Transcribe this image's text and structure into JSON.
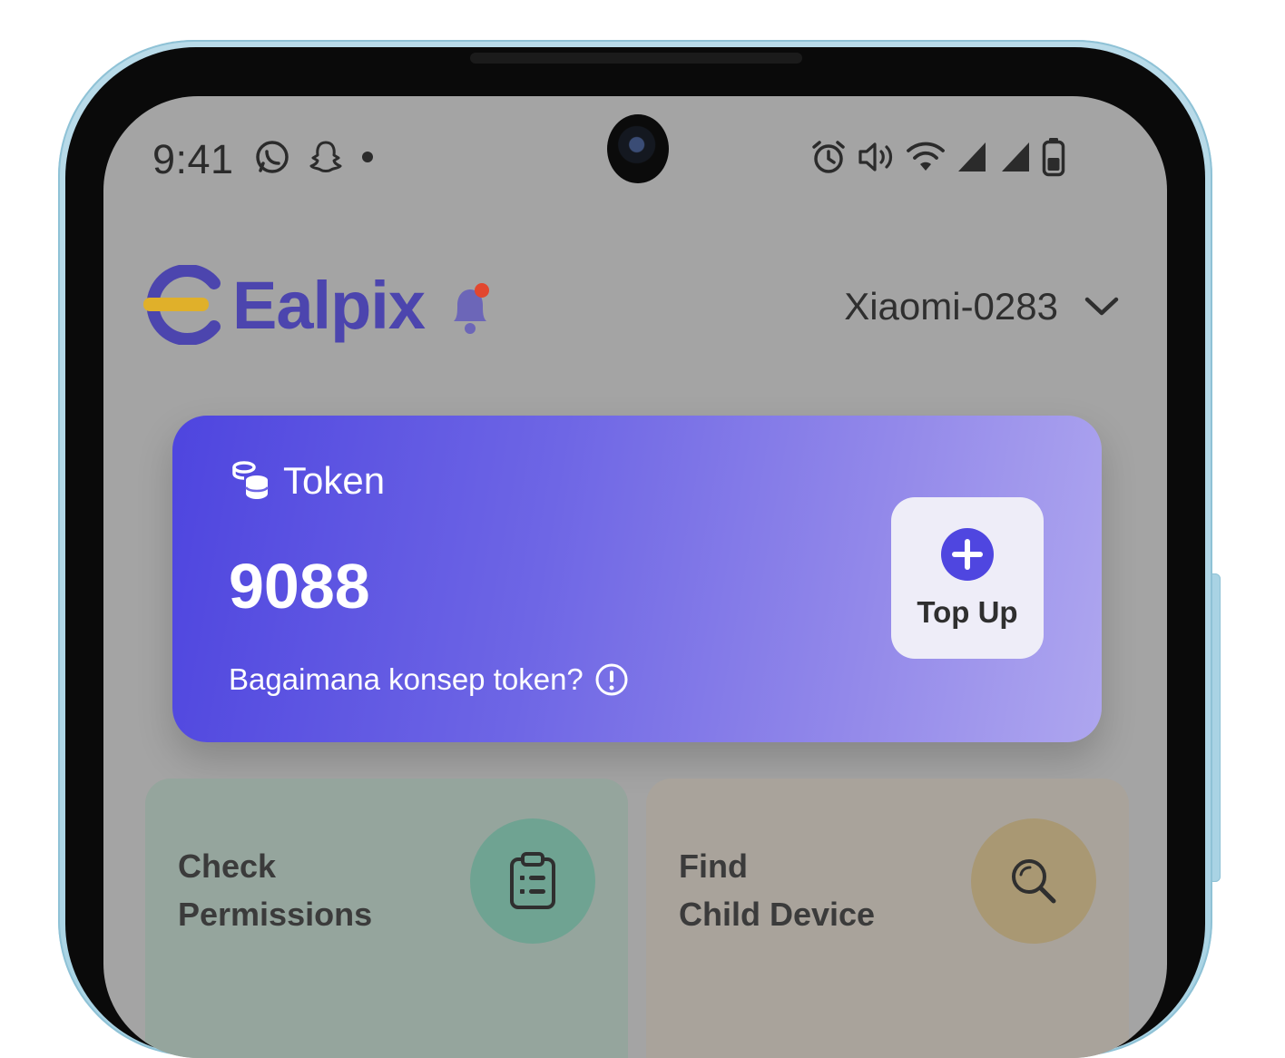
{
  "status_bar": {
    "time": "9:41",
    "left_icons": [
      "whatsapp-icon",
      "snapchat-icon",
      "dot-icon"
    ],
    "right_icons": [
      "alarm-icon",
      "volume-icon",
      "wifi-icon",
      "signal-icon",
      "signal-icon",
      "battery-icon"
    ]
  },
  "header": {
    "app_name": "Ealpix",
    "device_name": "Xiaomi-0283",
    "colors": {
      "brand": "#4c45ae",
      "accent": "#e0b02a",
      "notification_dot": "#e2472f"
    }
  },
  "token_card": {
    "label": "Token",
    "value": "9088",
    "help_text": "Bagaimana konsep token?",
    "topup_label": "Top Up",
    "colors": {
      "gradient_start": "#4e45df",
      "gradient_end": "#aea6ef"
    }
  },
  "features": {
    "permissions": {
      "title": "Check\nPermissions",
      "icon": "clipboard-icon",
      "color": "#6fa392"
    },
    "find": {
      "title": "Find\nChild Device",
      "icon": "search-icon",
      "color": "#a99873"
    }
  }
}
